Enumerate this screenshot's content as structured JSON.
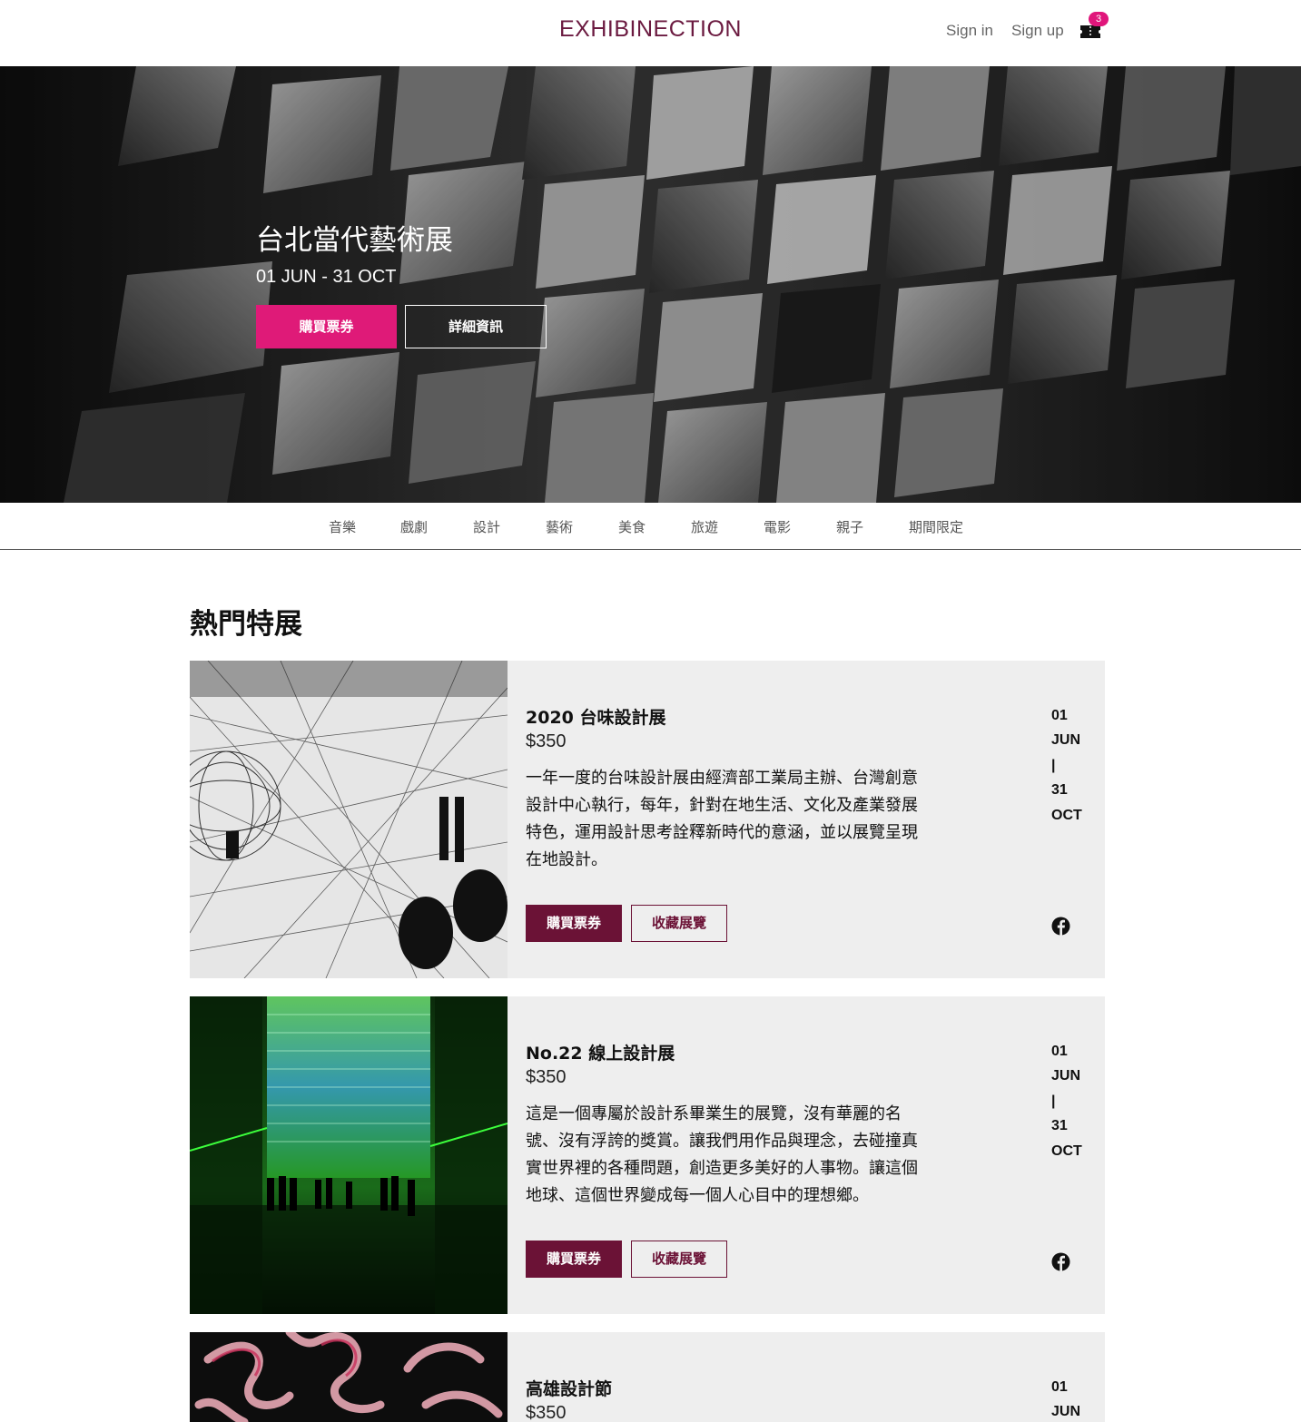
{
  "header": {
    "brand": "EXHIBINECTION",
    "sign_in": "Sign in",
    "sign_up": "Sign up",
    "cart_count": "3",
    "cart_icon": "ticket-cart-icon"
  },
  "hero": {
    "title": "台北當代藝術展",
    "date": "01 JUN - 31 OCT",
    "buy_label": "購買票券",
    "info_label": "詳細資訊"
  },
  "categories": [
    "音樂",
    "戲劇",
    "設計",
    "藝術",
    "美食",
    "旅遊",
    "電影",
    "親子",
    "期間限定"
  ],
  "section": {
    "title": "熱門特展"
  },
  "exhibitions": [
    {
      "title": "2020 台味設計展",
      "price": "$350",
      "desc_lines": [
        "一年一度的台味設計展由經濟部工業局主辦、台灣創意",
        "設計中心執行，每年，針對在地生活、文化及產業發展",
        "特色，運用設計思考詮釋新時代的意涵，並以展覽呈現",
        "在地設計。"
      ],
      "buy_label": "購買票券",
      "fav_label": "收藏展覽",
      "start_day": "01",
      "start_month": "JUN",
      "sep": "|",
      "end_day": "31",
      "end_month": "OCT"
    },
    {
      "title": "No.22 線上設計展",
      "price": "$350",
      "desc_lines": [
        "這是一個專屬於設計系畢業生的展覽，沒有華麗的名",
        "號、沒有浮誇的獎賞。讓我們用作品與理念，去碰撞真",
        "實世界裡的各種問題，創造更多美好的人事物。讓這個",
        "地球、這個世界變成每一個人心目中的理想鄉。"
      ],
      "buy_label": "購買票券",
      "fav_label": "收藏展覽",
      "start_day": "01",
      "start_month": "JUN",
      "sep": "|",
      "end_day": "31",
      "end_month": "OCT"
    },
    {
      "title": "高雄設計節",
      "price": "$350",
      "start_day": "01",
      "start_month": "JUN"
    }
  ],
  "colors": {
    "brand": "#6b1a40",
    "hero_button": "#df1a78",
    "card_button": "#6b1236",
    "card_bg": "#eeeeee"
  }
}
